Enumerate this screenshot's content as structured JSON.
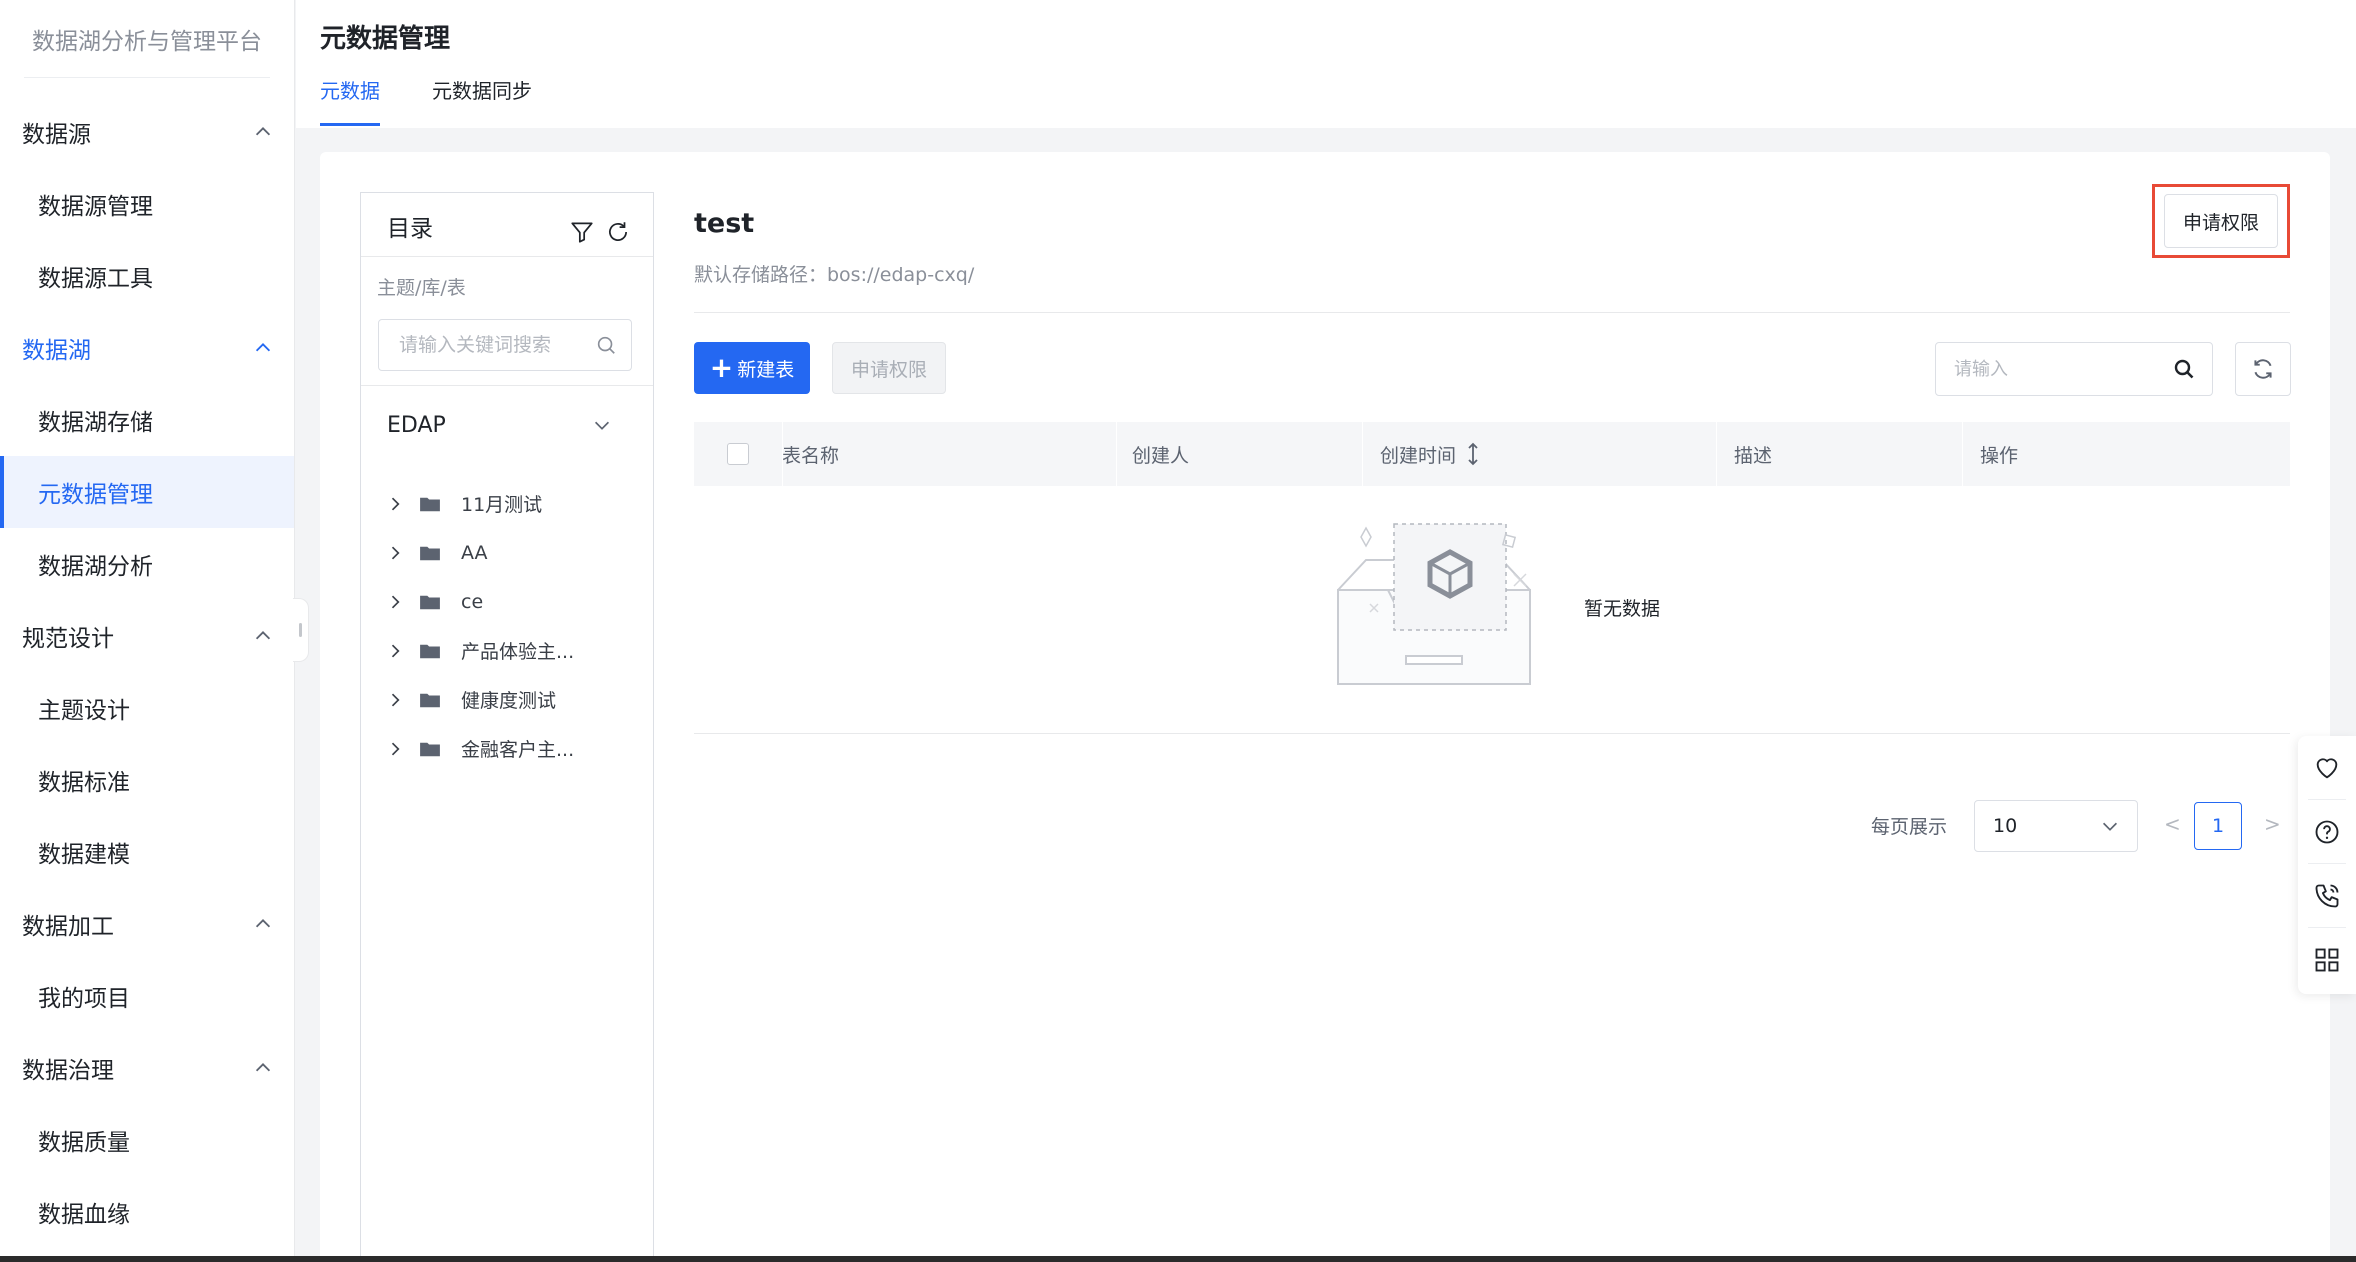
{
  "sidebar": {
    "brand": "数据湖分析与管理平台",
    "groups": [
      {
        "label": "数据源",
        "items": [
          "数据源管理",
          "数据源工具"
        ]
      },
      {
        "label": "数据湖",
        "items": [
          "数据湖存储",
          "元数据管理",
          "数据湖分析"
        ]
      },
      {
        "label": "规范设计",
        "items": [
          "主题设计",
          "数据标准",
          "数据建模"
        ]
      },
      {
        "label": "数据加工",
        "items": [
          "我的项目"
        ]
      },
      {
        "label": "数据治理",
        "items": [
          "数据质量",
          "数据血缘"
        ]
      }
    ],
    "active_group": "数据湖",
    "active_item": "元数据管理"
  },
  "header": {
    "title": "元数据管理",
    "tabs": [
      {
        "label": "元数据",
        "active": true
      },
      {
        "label": "元数据同步",
        "active": false
      }
    ]
  },
  "catalog": {
    "title": "目录",
    "subtitle": "主题/库/表",
    "search_placeholder": "请输入关键词搜索",
    "database": "EDAP",
    "tree": [
      "11月测试",
      "AA",
      "ce",
      "产品体验主...",
      "健康度测试",
      "金融客户主..."
    ]
  },
  "detail": {
    "name": "test",
    "storage_path": "默认存储路径：bos://edap-cxq/",
    "request_permission_label": "申请权限",
    "new_table_label": "新建表",
    "request_permission_disabled_label": "申请权限",
    "search_placeholder": "请输入",
    "columns": [
      "表名称",
      "创建人",
      "创建时间",
      "描述",
      "操作"
    ],
    "empty_text": "暂无数据"
  },
  "pagination": {
    "per_page_label": "每页展示",
    "page_size": "10",
    "prev": "<",
    "current_page": "1",
    "next": ">"
  },
  "colors": {
    "accent": "#2468f2",
    "highlight_border": "#e84a36"
  }
}
